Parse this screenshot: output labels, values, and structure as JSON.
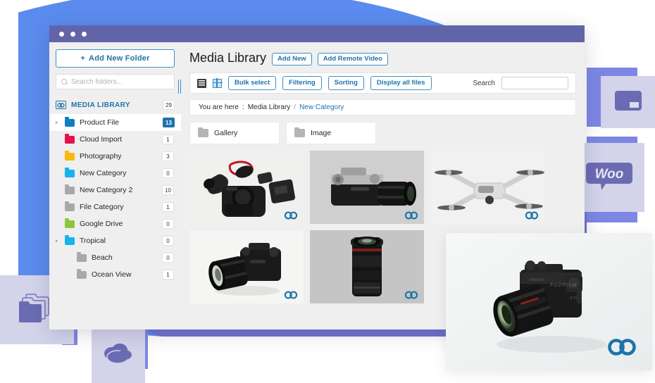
{
  "window": {
    "titlebar_dots": 3,
    "titlebar_color": "#6264a9"
  },
  "sidebar": {
    "add_folder_label": "Add New Folder",
    "add_folder_plus": "+",
    "search_placeholder": "Search folders...",
    "library": {
      "label": "MEDIA LIBRARY",
      "count": "29"
    },
    "items": [
      {
        "label": "Product File",
        "count": "13",
        "color": "#0d7ec2",
        "caret": true,
        "indent": 0,
        "selected": true
      },
      {
        "label": "Cloud Import",
        "count": "1",
        "color": "#e5124c",
        "caret": false,
        "indent": 0,
        "selected": false
      },
      {
        "label": "Photography",
        "count": "3",
        "color": "#fbb812",
        "caret": false,
        "indent": 0,
        "selected": false
      },
      {
        "label": "New Category",
        "count": "0",
        "color": "#17b2f0",
        "caret": false,
        "indent": 0,
        "selected": false
      },
      {
        "label": "New Category 2",
        "count": "10",
        "color": "#a8a8a8",
        "caret": false,
        "indent": 0,
        "selected": false
      },
      {
        "label": "File Category",
        "count": "1",
        "color": "#a8a8a8",
        "caret": false,
        "indent": 0,
        "selected": false
      },
      {
        "label": "Google Drive",
        "count": "0",
        "color": "#8cc63e",
        "caret": false,
        "indent": 0,
        "selected": false
      },
      {
        "label": "Tropical",
        "count": "0",
        "color": "#17b2f0",
        "caret": true,
        "indent": 0,
        "selected": false
      },
      {
        "label": "Beach",
        "count": "0",
        "color": "#a8a8a8",
        "caret": false,
        "indent": 1,
        "selected": false
      },
      {
        "label": "Ocean View",
        "count": "1",
        "color": "#a8a8a8",
        "caret": false,
        "indent": 1,
        "selected": false
      }
    ]
  },
  "header": {
    "title": "Media Library",
    "add_new_label": "Add New",
    "add_remote_video_label": "Add Remote Video"
  },
  "toolbar": {
    "list_view_icon": "list-view-icon",
    "grid_view_icon": "grid-view-icon",
    "buttons": [
      "Bulk select",
      "Filtering",
      "Sorting",
      "Display all files"
    ],
    "search_label": "Search",
    "search_value": "",
    "search_placeholder": ""
  },
  "breadcrumb": {
    "prefix": "You are here",
    "colon": ":",
    "root": "Media Library",
    "separator": "/",
    "current": "New Category"
  },
  "subfolders": [
    {
      "label": "Gallery"
    },
    {
      "label": "Image"
    }
  ],
  "gallery": {
    "watermark_icon": "chain-link-logo-icon",
    "watermark_color": "#1b74ab",
    "items": [
      {
        "name": "dslr-camera-kit-flatlay",
        "bg": "#f0f0ee"
      },
      {
        "name": "silver-mirrorless-camera",
        "bg": "#cfcfcf"
      },
      {
        "name": "white-drone",
        "bg": "#f1f1f1"
      },
      {
        "name": "dslr-with-zoom-lens",
        "bg": "#f5f5f3"
      },
      {
        "name": "telephoto-lens",
        "bg": "#c9c9c9"
      }
    ],
    "feature_item": {
      "name": "black-mirrorless-camera-with-lens",
      "bg": "#f2f4f4"
    }
  },
  "decor": {
    "blue_circle_color": "#5b8bee",
    "purple_ellipse_color": "#6f73cf",
    "tile_bg": "#d3d3ea",
    "tile_accent": "#7d87e3",
    "icon_purple": "#6b6bb4",
    "tiles": [
      {
        "name": "window-tile",
        "icon": "browser-window-icon"
      },
      {
        "name": "woo-tile",
        "icon": "woocommerce-logo-icon",
        "text": "Woo"
      },
      {
        "name": "folders-tile",
        "icon": "multiple-folders-icon"
      },
      {
        "name": "cloud-tile",
        "icon": "cloud-icon"
      }
    ]
  }
}
